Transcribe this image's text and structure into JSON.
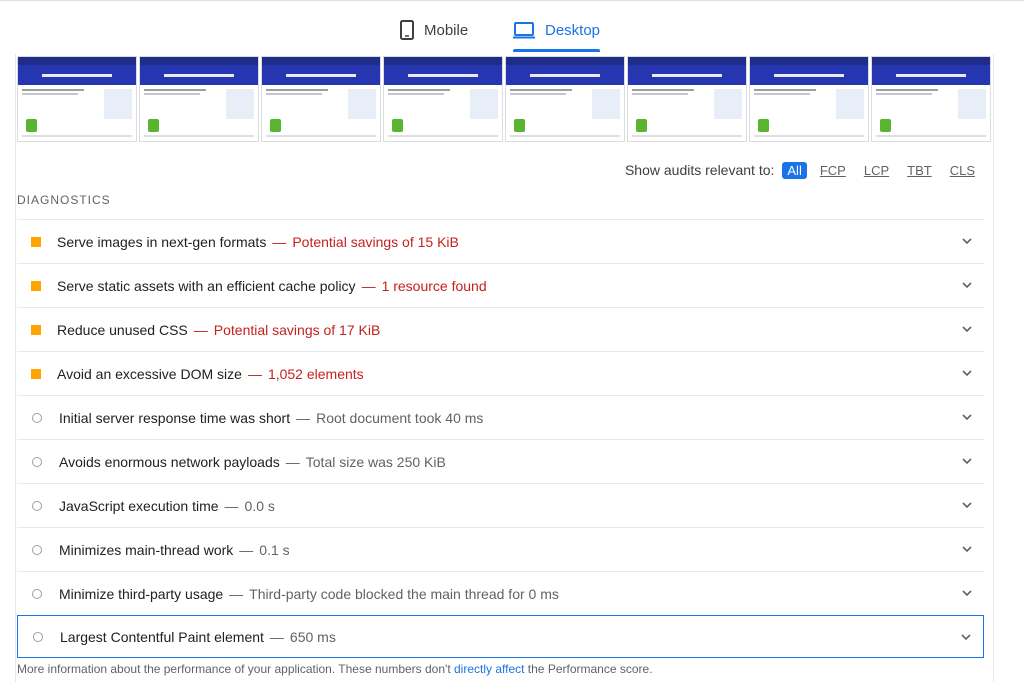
{
  "tabs": [
    {
      "label": "Mobile",
      "icon": "phone-icon",
      "active": false
    },
    {
      "label": "Desktop",
      "icon": "laptop-icon",
      "active": true
    }
  ],
  "filmstrip": {
    "frame_count": 8
  },
  "filter": {
    "label": "Show audits relevant to:",
    "options": [
      "All",
      "FCP",
      "LCP",
      "TBT",
      "CLS"
    ],
    "selected": "All"
  },
  "diagnostics": {
    "title": "DIAGNOSTICS",
    "items": [
      {
        "title": "Serve images in next-gen formats",
        "detail": "Potential savings of 15 KiB",
        "status": "warn"
      },
      {
        "title": "Serve static assets with an efficient cache policy",
        "detail": "1 resource found",
        "status": "warn"
      },
      {
        "title": "Reduce unused CSS",
        "detail": "Potential savings of 17 KiB",
        "status": "warn"
      },
      {
        "title": "Avoid an excessive DOM size",
        "detail": "1,052 elements",
        "status": "warn"
      },
      {
        "title": "Initial server response time was short",
        "detail": "Root document took 40 ms",
        "status": "pass"
      },
      {
        "title": "Avoids enormous network payloads",
        "detail": "Total size was 250 KiB",
        "status": "pass"
      },
      {
        "title": "JavaScript execution time",
        "detail": "0.0 s",
        "status": "pass"
      },
      {
        "title": "Minimizes main-thread work",
        "detail": "0.1 s",
        "status": "pass"
      },
      {
        "title": "Minimize third-party usage",
        "detail": "Third-party code blocked the main thread for 0 ms",
        "status": "pass"
      },
      {
        "title": "Largest Contentful Paint element",
        "detail": "650 ms",
        "status": "pass"
      }
    ],
    "separator": "—"
  },
  "footer": {
    "before": "More information about the performance of your application. These numbers don't ",
    "link": "directly affect",
    "after": " the Performance score."
  },
  "colors": {
    "accent": "#1a73e8",
    "warn_icon": "#ffa400",
    "warn_text": "#c5221f",
    "pass_icon": "#9aa0a6"
  }
}
